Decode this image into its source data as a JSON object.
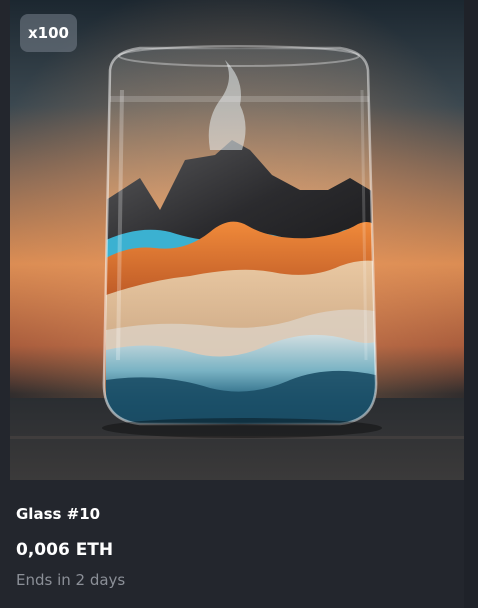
{
  "card": {
    "edition_badge": "x100",
    "title": "Glass #10",
    "price": "0,006 ETH",
    "ends": "Ends in 2 days"
  },
  "colors": {
    "card_background": "#23262d",
    "title_text": "#ffffff",
    "muted_text": "#8b8f97",
    "badge_background": "#78828c"
  }
}
